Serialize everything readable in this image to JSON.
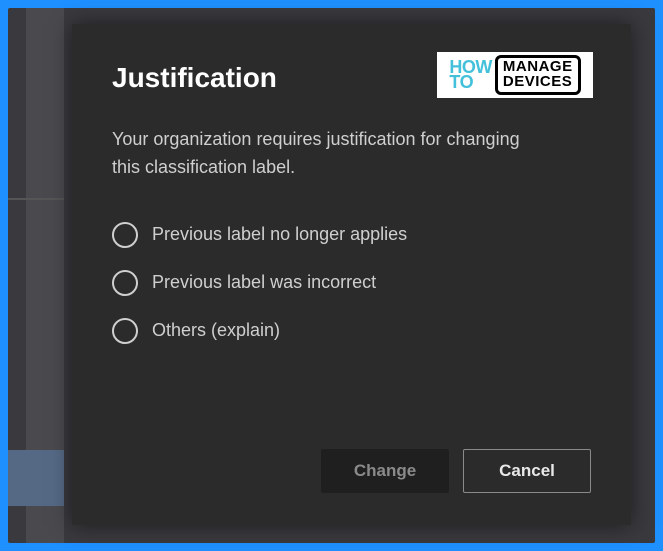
{
  "watermark": {
    "line1": "HOW",
    "line2": "TO",
    "box_line1": "MANAGE",
    "box_line2": "DEVICES"
  },
  "dialog": {
    "title": "Justification",
    "description": "Your organization requires justification for changing this classification label.",
    "options": [
      {
        "label": "Previous label no longer applies"
      },
      {
        "label": "Previous label was incorrect"
      },
      {
        "label": "Others (explain)"
      }
    ],
    "buttons": {
      "primary": "Change",
      "secondary": "Cancel"
    }
  }
}
